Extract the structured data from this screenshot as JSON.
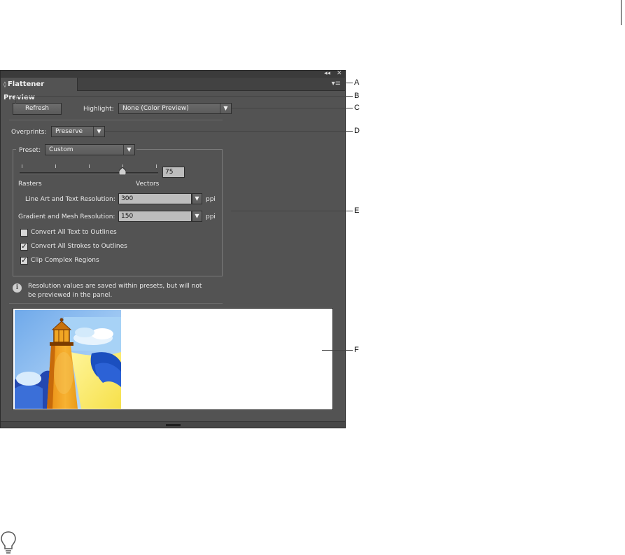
{
  "panel": {
    "title": "Flattener Preview",
    "title_arrows": "◊",
    "collapse_glyph": "◂◂",
    "close_glyph": "✕",
    "menu_glyph": "▾≡",
    "refresh_label": "Refresh",
    "highlight_label": "Highlight:",
    "highlight_value": "None (Color Preview)",
    "overprints_label": "Overprints:",
    "overprints_value": "Preserve",
    "preset_label": "Preset:",
    "preset_value": "Custom",
    "slider_value": "75",
    "rasters_label": "Rasters",
    "vectors_label": "Vectors",
    "line_art_label": "Line Art and Text Resolution:",
    "line_art_value": "300",
    "gradient_label": "Gradient and Mesh Resolution:",
    "gradient_value": "150",
    "ppi_unit": "ppi",
    "checkboxes": [
      {
        "label": "Convert All Text to Outlines",
        "checked": false
      },
      {
        "label": "Convert All Strokes to Outlines",
        "checked": true
      },
      {
        "label": "Clip Complex Regions",
        "checked": true
      }
    ],
    "info_text_1": "Resolution values are saved within presets, but will not",
    "info_text_2": "be previewed in the panel.",
    "dropdown_arrow": "▼"
  },
  "callouts": [
    "A",
    "B",
    "C",
    "D",
    "E",
    "F"
  ],
  "colors": {
    "panel_bg": "#535353",
    "tab_bg": "#424242",
    "preview_bg": "#ffffff",
    "lighthouse_orange": "#f5a623",
    "sky_blue": "#8fc4f2"
  },
  "icons": [
    "collapse-icon",
    "close-icon",
    "panel-menu-icon",
    "info-icon",
    "lighthouse-image",
    "lightbulb-icon"
  ]
}
